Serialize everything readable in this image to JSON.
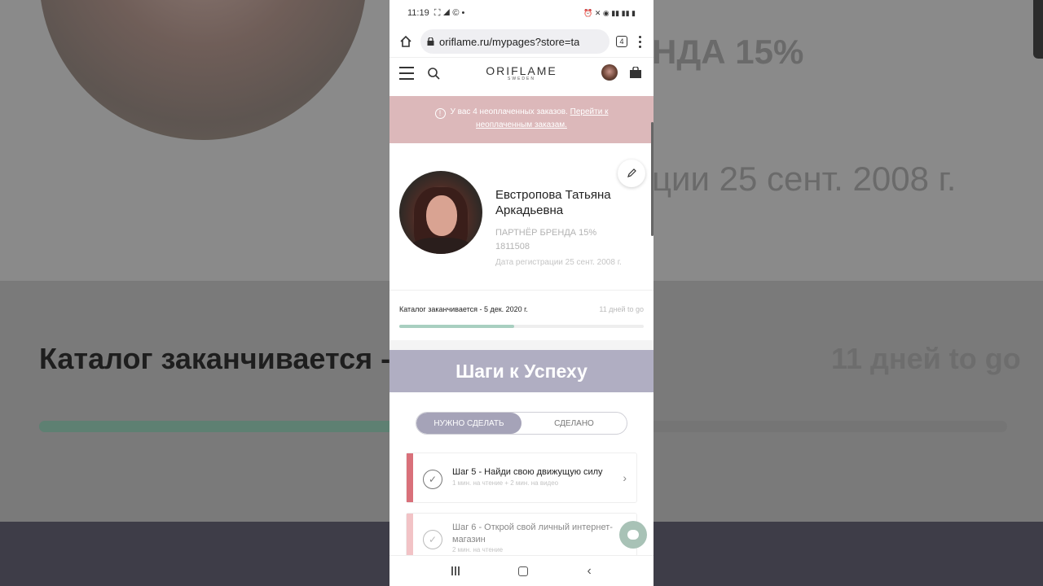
{
  "status": {
    "time": "11:19",
    "icons_left": "⛶ ◢ © •",
    "icons_right": "⏰ ✕ ◉ ▮▮ ▮▮ ▮"
  },
  "browser": {
    "url": "oriflame.ru/mypages?store=ta",
    "tab_count": "4"
  },
  "site": {
    "logo": "ORIFLAME",
    "logo_sub": "SWEDEN"
  },
  "alert": {
    "text": "У вас 4 неоплаченных заказов.",
    "link": "Перейти к неоплаченным заказам."
  },
  "profile": {
    "name": "Евстропова Татьяна Аркадьевна",
    "rank": "ПАРТНЁР БРЕНДА 15%",
    "id": "1811508",
    "reg_date": "Дата регистрации 25 сент. 2008 г."
  },
  "catalog": {
    "label": "Каталог заканчивается - 5 дек. 2020 г.",
    "days": "11 дней to go",
    "progress": 0.47
  },
  "steps": {
    "header": "Шаги к Успеху",
    "tab_todo": "НУЖНО СДЕЛАТЬ",
    "tab_done": "СДЕЛАНО",
    "items": [
      {
        "title": "Шаг 5 - Найди свою движущую силу",
        "meta": "1 мин. на чтение + 2 мин. на видео",
        "accent": "#d9707a"
      },
      {
        "title": "Шаг 6 - Открой свой личный интернет-магазин",
        "meta": "2 мин. на чтение",
        "accent": "#f2c3c6"
      }
    ]
  },
  "background": {
    "text_rank": "НДА 15%",
    "text_reg": "ции 25 сент. 2008 г.",
    "text_catalog": "Каталог заканчивается -",
    "text_days": "11 дней to go"
  }
}
